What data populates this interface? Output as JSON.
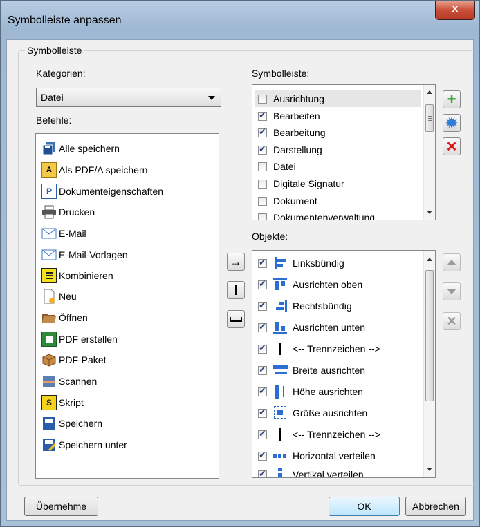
{
  "window": {
    "title": "Symbolleiste anpassen",
    "close_glyph": "x"
  },
  "group_label": "Symbolleiste",
  "categories": {
    "label": "Kategorien:",
    "selected": "Datei"
  },
  "commands": {
    "label": "Befehle:",
    "items": [
      {
        "label": "Alle speichern",
        "icon": "save-all-icon"
      },
      {
        "label": "Als PDF/A speichern",
        "icon": "pdfa-icon"
      },
      {
        "label": "Dokumenteigenschaften",
        "icon": "document-properties-icon"
      },
      {
        "label": "Drucken",
        "icon": "printer-icon"
      },
      {
        "label": "E-Mail",
        "icon": "envelope-icon"
      },
      {
        "label": "E-Mail-Vorlagen",
        "icon": "envelope-template-icon"
      },
      {
        "label": "Kombinieren",
        "icon": "combine-icon"
      },
      {
        "label": "Neu",
        "icon": "new-document-icon"
      },
      {
        "label": "Öffnen",
        "icon": "folder-open-icon"
      },
      {
        "label": "PDF erstellen",
        "icon": "create-pdf-icon"
      },
      {
        "label": "PDF-Paket",
        "icon": "package-icon"
      },
      {
        "label": "Scannen",
        "icon": "scanner-icon"
      },
      {
        "label": "Skript",
        "icon": "script-icon"
      },
      {
        "label": "Speichern",
        "icon": "save-icon"
      },
      {
        "label": "Speichern unter",
        "icon": "save-as-icon"
      }
    ]
  },
  "toolbars": {
    "label": "Symbolleiste:",
    "items": [
      {
        "label": "Ausrichtung",
        "checked": false
      },
      {
        "label": "Bearbeiten",
        "checked": true
      },
      {
        "label": "Bearbeitung",
        "checked": true
      },
      {
        "label": "Darstellung",
        "checked": true
      },
      {
        "label": "Datei",
        "checked": false
      },
      {
        "label": "Digitale Signatur",
        "checked": false
      },
      {
        "label": "Dokument",
        "checked": false
      },
      {
        "label": "Dokumentenverwaltung",
        "checked": false
      }
    ]
  },
  "objects": {
    "label": "Objekte:",
    "items": [
      {
        "label": "Linksbündig",
        "checked": true,
        "icon": "align-left-icon"
      },
      {
        "label": "Ausrichten oben",
        "checked": true,
        "icon": "align-top-icon"
      },
      {
        "label": "Rechtsbündig",
        "checked": true,
        "icon": "align-right-icon"
      },
      {
        "label": "Ausrichten unten",
        "checked": true,
        "icon": "align-bottom-icon"
      },
      {
        "label": "<-- Trennzeichen -->",
        "checked": true,
        "icon": "separator-icon"
      },
      {
        "label": "Breite ausrichten",
        "checked": true,
        "icon": "match-width-icon"
      },
      {
        "label": "Höhe ausrichten",
        "checked": true,
        "icon": "match-height-icon"
      },
      {
        "label": "Größe ausrichten",
        "checked": true,
        "icon": "match-size-icon"
      },
      {
        "label": "<-- Trennzeichen -->",
        "checked": true,
        "icon": "separator-icon"
      },
      {
        "label": "Horizontal verteilen",
        "checked": true,
        "icon": "distribute-horizontal-icon"
      },
      {
        "label": "Vertikal verteilen",
        "checked": true,
        "icon": "distribute-vertical-icon"
      }
    ]
  },
  "buttons": {
    "apply": "Übernehme",
    "ok": "OK",
    "cancel": "Abbrechen"
  },
  "colors": {
    "accent_green": "#3aa334",
    "accent_blue": "#2f7dd6",
    "delete_red": "#d8161b"
  }
}
